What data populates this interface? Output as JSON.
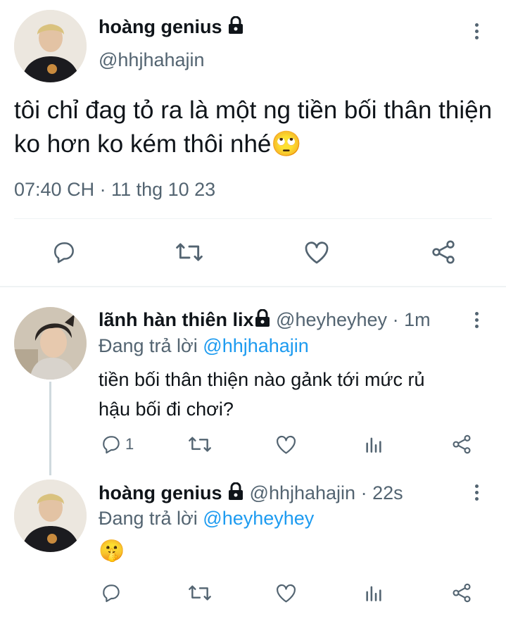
{
  "main_tweet": {
    "display_name": "hoàng genius",
    "handle": "@hhjhahajin",
    "text": "tôi chỉ đag tỏ ra là một ng tiền bối thân thiện ko hơn ko kém thôi nhé🙄",
    "timestamp": "07:40 CH · 11 thg 10 23",
    "actions": [
      "reply-icon",
      "retweet-icon",
      "like-icon",
      "share-icon"
    ]
  },
  "replies": [
    {
      "display_name": "lãnh hàn thiên lix",
      "handle": "@heyheyhey",
      "time": "· 1m",
      "replying_prefix": "Đang trả lời",
      "replying_to": "@hhjhahajin",
      "text_line1": "tiền bối thân thiện nào gảnk tới mức rủ",
      "text_line2": "hậu bối đi chơi?",
      "reply_count": "1"
    },
    {
      "display_name": "hoàng genius",
      "handle": "@hhjhahajin",
      "time": "· 22s",
      "replying_prefix": "Đang trả lời",
      "replying_to": "@heyheyhey",
      "text": "🤫",
      "reply_count": ""
    }
  ],
  "colors": {
    "text": "#0f1419",
    "secondary": "#536471",
    "accent": "#1d9bf0",
    "divider": "#eff3f4"
  }
}
